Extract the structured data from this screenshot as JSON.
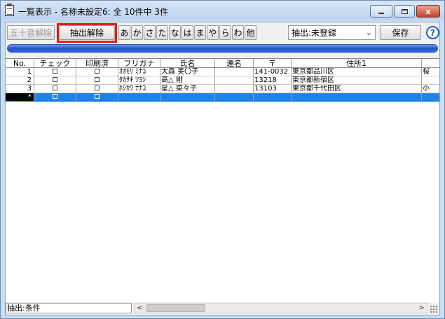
{
  "window": {
    "title": "一覧表示 - 名称未設定6: 全 10件中 3件",
    "close_glyph": "x"
  },
  "toolbar": {
    "reset_kana_label": "五十音解除",
    "clear_filter_label": "抽出解除",
    "kana_buttons": [
      "あ",
      "か",
      "さ",
      "た",
      "な",
      "は",
      "ま",
      "や",
      "ら",
      "わ",
      "他"
    ],
    "filter_select_value": "抽出:未登録",
    "save_label": "保存",
    "help_glyph": "?"
  },
  "progress": {
    "fraction": 1.0
  },
  "table": {
    "columns": [
      "No.",
      "チェック",
      "印刷済",
      "フリガナ",
      "氏名",
      "連名",
      "〒",
      "住所1",
      ""
    ],
    "rows": [
      {
        "no": "1",
        "furigana": "ｵｵﾓﾘ ﾐﾅｺ",
        "name": "大森 美〇子",
        "joint": "",
        "zip": "141-0032",
        "addr1": "東京都品川区",
        "extra": "桜"
      },
      {
        "no": "2",
        "furigana": "ﾀｶｻｷ ﾂﾖｼ",
        "name": "高△ 剛",
        "joint": "",
        "zip": "13218",
        "addr1": "東京都新宿区",
        "extra": ""
      },
      {
        "no": "3",
        "furigana": "ﾎｼｶﾜ ﾅﾅｺ",
        "name": "星△ 菜々子",
        "joint": "",
        "zip": "13103",
        "addr1": "東京都千代田区",
        "extra": "小"
      }
    ],
    "new_row_marker": "*"
  },
  "status": {
    "text": "抽出:条件",
    "scroll_left_glyph": "<",
    "scroll_right_glyph": ">"
  },
  "colors": {
    "highlight": "#e21b1b",
    "selection": "#1e82e6",
    "progress": "#2456cf"
  }
}
